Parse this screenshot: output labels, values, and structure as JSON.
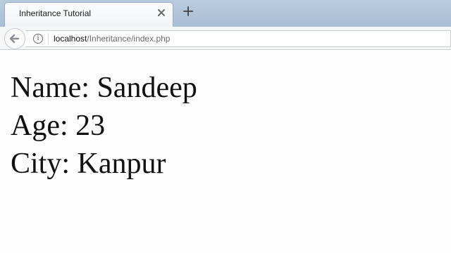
{
  "tab": {
    "title": "Inheritance Tutorial",
    "close_icon": "close-icon",
    "new_tab_icon": "plus-icon"
  },
  "nav": {
    "back_icon": "arrow-left-icon",
    "info_icon": "info-icon",
    "url_host": "localhost",
    "url_path": "/Inheritance/index.php"
  },
  "page": {
    "lines": [
      "Name: Sandeep",
      "Age: 23",
      "City: Kanpur"
    ]
  }
}
